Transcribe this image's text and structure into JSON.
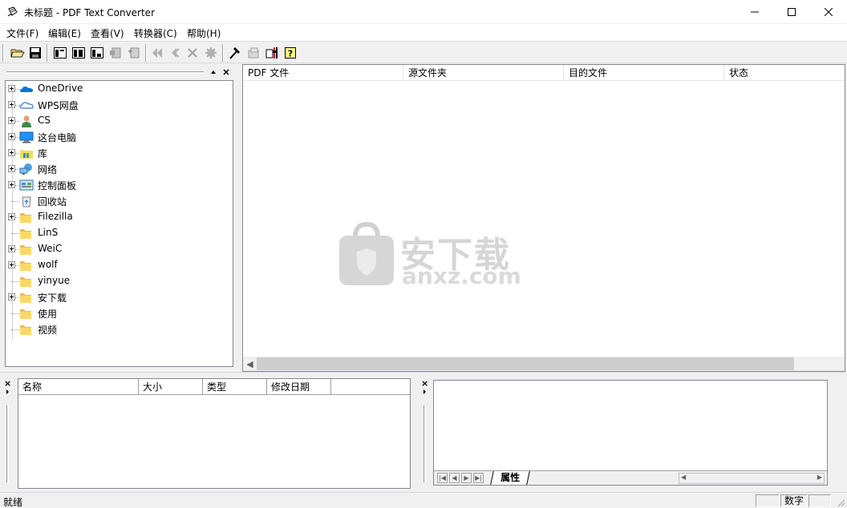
{
  "window": {
    "title": "未标题 - PDF Text Converter"
  },
  "menu": [
    {
      "label": "文件(F)"
    },
    {
      "label": "编辑(E)"
    },
    {
      "label": "查看(V)"
    },
    {
      "label": "转换器(C)"
    },
    {
      "label": "帮助(H)"
    }
  ],
  "tree": {
    "items": [
      {
        "label": "OneDrive",
        "icon": "onedrive-icon",
        "expandable": true
      },
      {
        "label": "WPS网盘",
        "icon": "cloud-icon",
        "expandable": true
      },
      {
        "label": "CS",
        "icon": "user-icon",
        "expandable": true
      },
      {
        "label": "这台电脑",
        "icon": "computer-icon",
        "expandable": true
      },
      {
        "label": "库",
        "icon": "library-icon",
        "expandable": true
      },
      {
        "label": "网络",
        "icon": "network-icon",
        "expandable": true
      },
      {
        "label": "控制面板",
        "icon": "control-panel-icon",
        "expandable": true
      },
      {
        "label": "回收站",
        "icon": "recycle-bin-icon",
        "expandable": false
      },
      {
        "label": "Filezilla",
        "icon": "folder-icon",
        "expandable": true
      },
      {
        "label": "LinS",
        "icon": "folder-icon",
        "expandable": false
      },
      {
        "label": "WeiC",
        "icon": "folder-icon",
        "expandable": true
      },
      {
        "label": "wolf",
        "icon": "folder-icon",
        "expandable": true
      },
      {
        "label": "yinyue",
        "icon": "folder-icon",
        "expandable": false
      },
      {
        "label": "安下载",
        "icon": "folder-icon",
        "expandable": true
      },
      {
        "label": "使用",
        "icon": "folder-icon",
        "expandable": false
      },
      {
        "label": "视频",
        "icon": "folder-icon",
        "expandable": false
      }
    ]
  },
  "main_list": {
    "columns": [
      "PDF 文件",
      "源文件夹",
      "目的文件",
      "状态"
    ]
  },
  "file_list": {
    "columns": [
      "名称",
      "大小",
      "类型",
      "修改日期"
    ]
  },
  "properties": {
    "tab_label": "属性"
  },
  "watermark": {
    "cn": "安下载",
    "en": "anxz.com"
  },
  "status": {
    "text": "就绪",
    "num_lock": "数字"
  },
  "colors": {
    "folder": "#ffd866",
    "onedrive": "#0a74d4",
    "accent_red": "#d42020"
  }
}
